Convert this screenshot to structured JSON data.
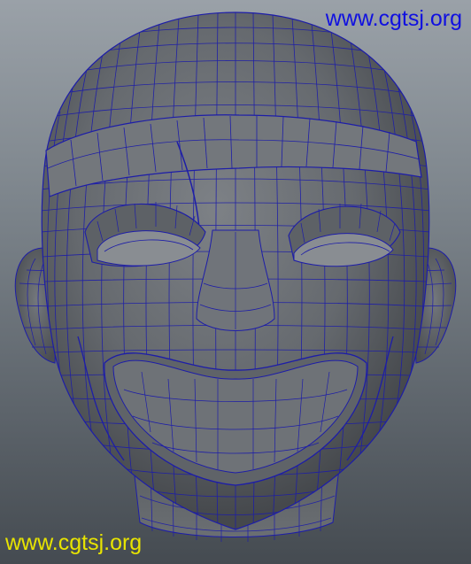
{
  "viewport": {
    "background_top": "#9aa1a8",
    "background_bottom": "#454b51"
  },
  "model": {
    "surface_color": "#6a6e73",
    "wireframe_color": "#1d1da8"
  },
  "watermarks": {
    "top_text": "www.cgtsj.org",
    "top_color": "#1010e0",
    "bottom_text": "www.cgtsj.org",
    "bottom_color": "#e8e400"
  }
}
